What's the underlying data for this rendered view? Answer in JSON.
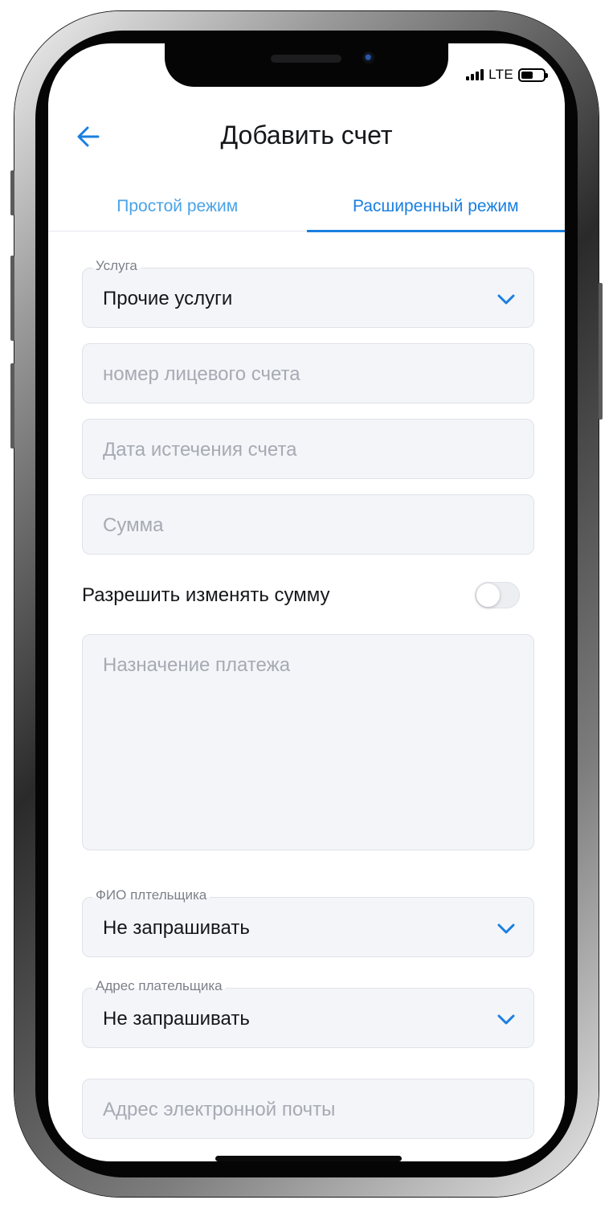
{
  "status_bar": {
    "network": "LTE"
  },
  "header": {
    "back_icon": "arrow-left-icon",
    "title": "Добавить счет"
  },
  "tabs": [
    {
      "label": "Простой режим",
      "active": false
    },
    {
      "label": "Расширенный режим",
      "active": true
    }
  ],
  "form": {
    "service": {
      "label": "Услуга",
      "value": "Прочие услуги"
    },
    "account_number": {
      "placeholder": "номер лицевого счета"
    },
    "expiry_date": {
      "placeholder": "Дата истечения счета"
    },
    "amount": {
      "placeholder": "Сумма"
    },
    "allow_change_amount": {
      "label": "Разрешить изменять сумму",
      "enabled": false
    },
    "purpose": {
      "placeholder": "Назначение платежа"
    },
    "payer_name": {
      "label": "ФИО плтельщика",
      "value": "Не запрашивать"
    },
    "payer_address": {
      "label": "Адрес плательщика",
      "value": "Не запрашивать"
    },
    "email": {
      "placeholder": "Адрес электронной почты"
    }
  },
  "colors": {
    "accent": "#1a7fe0",
    "accent_light": "#4aa3e8",
    "field_bg": "#f4f5f9",
    "placeholder": "#a6aab3"
  }
}
